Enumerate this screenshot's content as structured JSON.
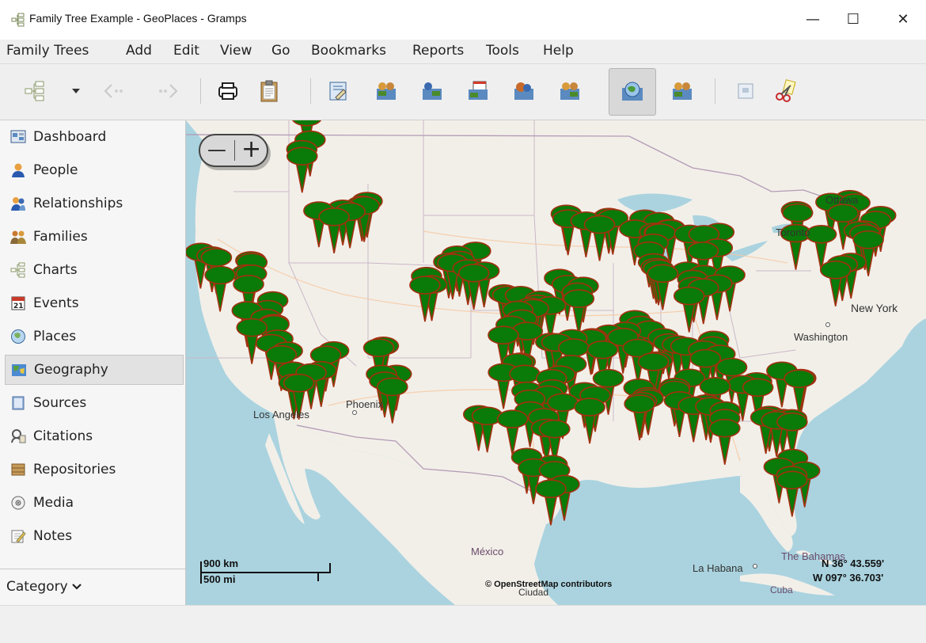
{
  "window": {
    "title": "Family Tree Example - GeoPlaces - Gramps",
    "minimize": "—",
    "maximize": "☐",
    "close": "✕"
  },
  "menubar": {
    "items": [
      "Family Trees",
      "Add",
      "Edit",
      "View",
      "Go",
      "Bookmarks",
      "Reports",
      "Tools",
      "Help"
    ]
  },
  "toolbar": {
    "icons": [
      "family-trees-icon",
      "dropdown-arrow-icon",
      "back-icon",
      "forward-icon",
      "print-icon",
      "clipboard-icon",
      "filter-editor-icon",
      "all-known-places-icon",
      "one-person-icon",
      "family-events-icon",
      "all-events-icon",
      "person-places-icon",
      "places-view-icon",
      "closest-places-icon",
      "preview-icon",
      "remove-icon"
    ],
    "active": "places-view-icon"
  },
  "sidebar": {
    "items": [
      {
        "label": "Dashboard",
        "icon": "dashboard-icon"
      },
      {
        "label": "People",
        "icon": "person-icon"
      },
      {
        "label": "Relationships",
        "icon": "relationships-icon"
      },
      {
        "label": "Families",
        "icon": "families-icon"
      },
      {
        "label": "Charts",
        "icon": "charts-icon"
      },
      {
        "label": "Events",
        "icon": "events-icon"
      },
      {
        "label": "Places",
        "icon": "globe-icon"
      },
      {
        "label": "Geography",
        "icon": "geography-icon"
      },
      {
        "label": "Sources",
        "icon": "sources-icon"
      },
      {
        "label": "Citations",
        "icon": "citations-icon"
      },
      {
        "label": "Repositories",
        "icon": "repositories-icon"
      },
      {
        "label": "Media",
        "icon": "media-icon"
      },
      {
        "label": "Notes",
        "icon": "notes-icon"
      }
    ],
    "selected": "Geography",
    "category": "Category"
  },
  "map": {
    "zoom_out": "—",
    "zoom_in": "+",
    "labels": {
      "ottawa": "Ottawa",
      "toronto": "Toronto",
      "new_york": "New York",
      "washington": "Washington",
      "los_angeles": "Los Angeles",
      "phoenix": "Phoenix",
      "mexico": "México",
      "ciudad": "Ciudad",
      "la_habana": "La Habana",
      "cuba": "Cuba",
      "bahamas": "The Bahamas"
    },
    "scale_km": "900 km",
    "scale_mi": "500 mi",
    "attribution": "© OpenStreetMap contributors",
    "coord_lat": "N 36° 43.559'",
    "coord_lon": "W 097° 36.703'",
    "marker_color": "#0a7a08",
    "marker_outline": "#a33010"
  }
}
